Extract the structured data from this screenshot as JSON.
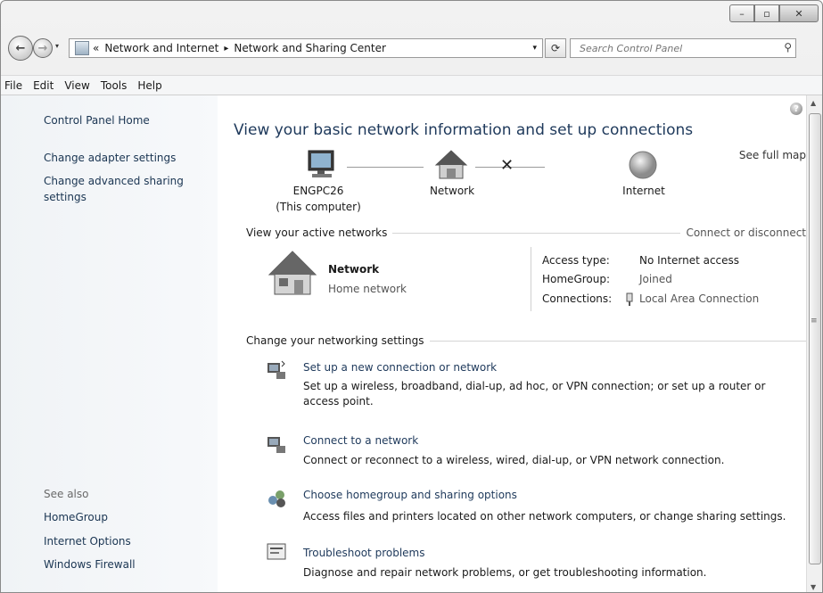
{
  "window": {
    "caption_buttons": {
      "minimize": "–",
      "maximize": "▫",
      "close": "✕"
    }
  },
  "address_bar": {
    "back_icon": "←",
    "forward_icon": "→",
    "nav_dropdown": "▾",
    "chevron": "«",
    "crumb1": "Network and Internet",
    "separator": "▸",
    "crumb2": "Network and Sharing Center",
    "dropdown": "▾",
    "refresh_icon": "⟳",
    "search_placeholder": "Search Control Panel",
    "search_icon": "⚲"
  },
  "menu": [
    "File",
    "Edit",
    "View",
    "Tools",
    "Help"
  ],
  "sidebar": {
    "home": "Control Panel Home",
    "adapter": "Change adapter settings",
    "advanced_line1": "Change advanced sharing",
    "advanced_line2": "settings",
    "see_also": "See also",
    "homegroup": "HomeGroup",
    "internet_options": "Internet Options",
    "firewall": "Windows Firewall"
  },
  "main": {
    "help_icon": "?",
    "title": "View your basic network information and set up connections",
    "see_full_map": "See full map",
    "map": {
      "computer_name": "ENGPC26",
      "computer_sub": "(This computer)",
      "network": "Network",
      "internet": "Internet",
      "broken_link": "✕"
    },
    "active_networks": {
      "heading": "View your active networks",
      "connect_link": "Connect or disconnect",
      "name": "Network",
      "type": "Home network",
      "access_type_label": "Access type:",
      "access_type_value": "No Internet access",
      "homegroup_label": "HomeGroup:",
      "homegroup_value": "Joined",
      "connections_label": "Connections:",
      "connections_value": "Local Area Connection"
    },
    "change_settings": {
      "heading": "Change your networking settings",
      "tasks": [
        {
          "title": "Set up a new connection or network",
          "desc": "Set up a wireless, broadband, dial-up, ad hoc, or VPN connection; or set up a router or access point."
        },
        {
          "title": "Connect to a network",
          "desc": "Connect or reconnect to a wireless, wired, dial-up, or VPN network connection."
        },
        {
          "title": "Choose homegroup and sharing options",
          "desc": "Access files and printers located on other network computers, or change sharing settings."
        },
        {
          "title": "Troubleshoot problems",
          "desc": "Diagnose and repair network problems, or get troubleshooting information."
        }
      ]
    }
  },
  "scrollbar": {
    "up": "▲",
    "down": "▼",
    "grip": "≡"
  }
}
